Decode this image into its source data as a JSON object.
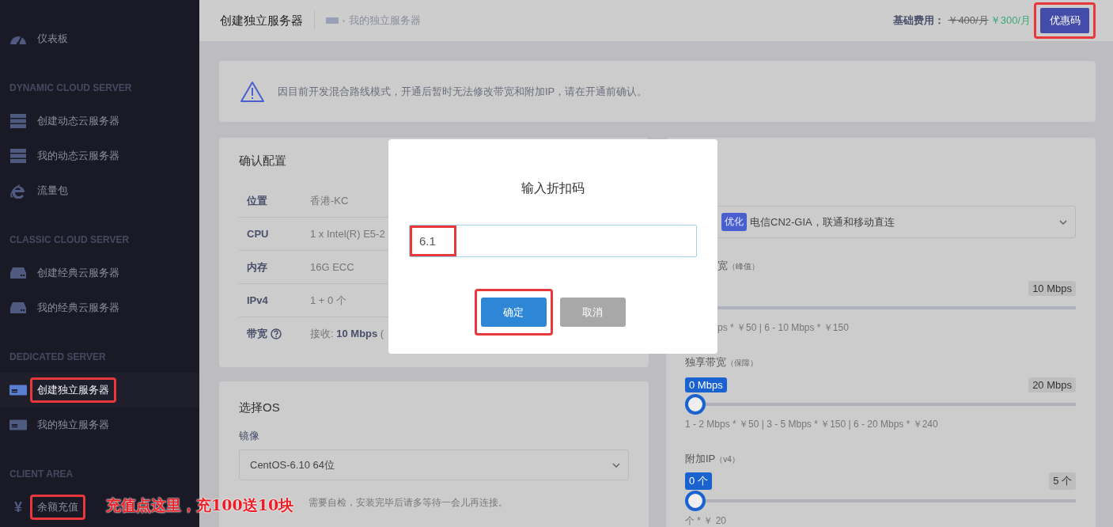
{
  "sidebar": [
    {
      "kind": "gauge",
      "label": "仪表板",
      "selected": false,
      "highlighted": false
    },
    {
      "kind": "heading",
      "label": "DYNAMIC CLOUD SERVER"
    },
    {
      "kind": "stack",
      "label": "创建动态云服务器",
      "selected": false,
      "highlighted": false
    },
    {
      "kind": "stack",
      "label": "我的动态云服务器",
      "selected": false,
      "highlighted": false
    },
    {
      "kind": "globe",
      "label": "流量包",
      "selected": false,
      "highlighted": false
    },
    {
      "kind": "heading",
      "label": "CLASSIC CLOUD SERVER"
    },
    {
      "kind": "drive",
      "label": "创建经典云服务器",
      "selected": false,
      "highlighted": false
    },
    {
      "kind": "drive",
      "label": "我的经典云服务器",
      "selected": false,
      "highlighted": false
    },
    {
      "kind": "heading",
      "label": "DEDICATED SERVER"
    },
    {
      "kind": "card",
      "label": "创建独立服务器",
      "selected": true,
      "highlighted": true
    },
    {
      "kind": "card",
      "label": "我的独立服务器",
      "selected": false,
      "highlighted": false
    },
    {
      "kind": "heading",
      "label": "CLIENT AREA"
    },
    {
      "kind": "glyph",
      "icon_text": "¥",
      "label": "余额充值",
      "selected": false,
      "highlighted": true
    }
  ],
  "header": {
    "title": "创建独立服务器",
    "breadcrumb": "我的独立服务器",
    "fee_label": "基础费用：",
    "old_price": "￥400/月",
    "new_price": "￥300/月",
    "coupon_button": {
      "label": "优惠码",
      "highlighted": true
    }
  },
  "notice": {
    "text": "因目前开发混合路线模式，开通后暂时无法修改带宽和附加IP，请在开通前确认。"
  },
  "config": {
    "title": "确认配置",
    "rows": [
      {
        "label": "位置",
        "value": "香港-KC"
      },
      {
        "label": "CPU",
        "value": "1 x Intel(R) E5-2"
      },
      {
        "label": "内存",
        "value": "16G ECC"
      },
      {
        "label": "IPv4",
        "value": "1 + 0 个"
      },
      {
        "label": "带宽",
        "kind": "help",
        "value": "接收: **10 Mbps** ("
      }
    ]
  },
  "os": {
    "title": "选择OS",
    "field_label": "镜像",
    "select_value": "CentOS-6.10 64位",
    "note": "需要自检，安装完毕后请多等待一会儿再连接。"
  },
  "network": {
    "route_tag": "优化",
    "route_text": "电信CN2-GIA，联通和移动直连",
    "sliders": [
      {
        "kind": "partial",
        "label": "宽",
        "hint": "（峰值）",
        "max": "10 Mbps",
        "prices": "ps * ￥50 | 6 - 10 Mbps * ￥150"
      },
      {
        "kind": "full",
        "label": "独享带宽",
        "hint": "（保障）",
        "value": "0 Mbps",
        "max": "20 Mbps",
        "level": 0,
        "prices": "1 - 2 Mbps * ￥50 | 3 - 5 Mbps * ￥150 | 6 - 20 Mbps * ￥240"
      },
      {
        "kind": "full",
        "label": "附加IP",
        "hint": "（v4）",
        "value": "0 个",
        "max": "5 个",
        "level": 0,
        "prices": "个 * ￥ 20"
      }
    ]
  },
  "modal": {
    "title": "输入折扣码",
    "input": {
      "value": "6.1",
      "highlighted": true
    },
    "buttons": [
      {
        "kind": "primary",
        "label": "确定",
        "highlighted": true
      },
      {
        "kind": "secondary",
        "label": "取消",
        "highlighted": false
      }
    ]
  },
  "annotation": {
    "text": "充值点这里，充100送10块"
  }
}
